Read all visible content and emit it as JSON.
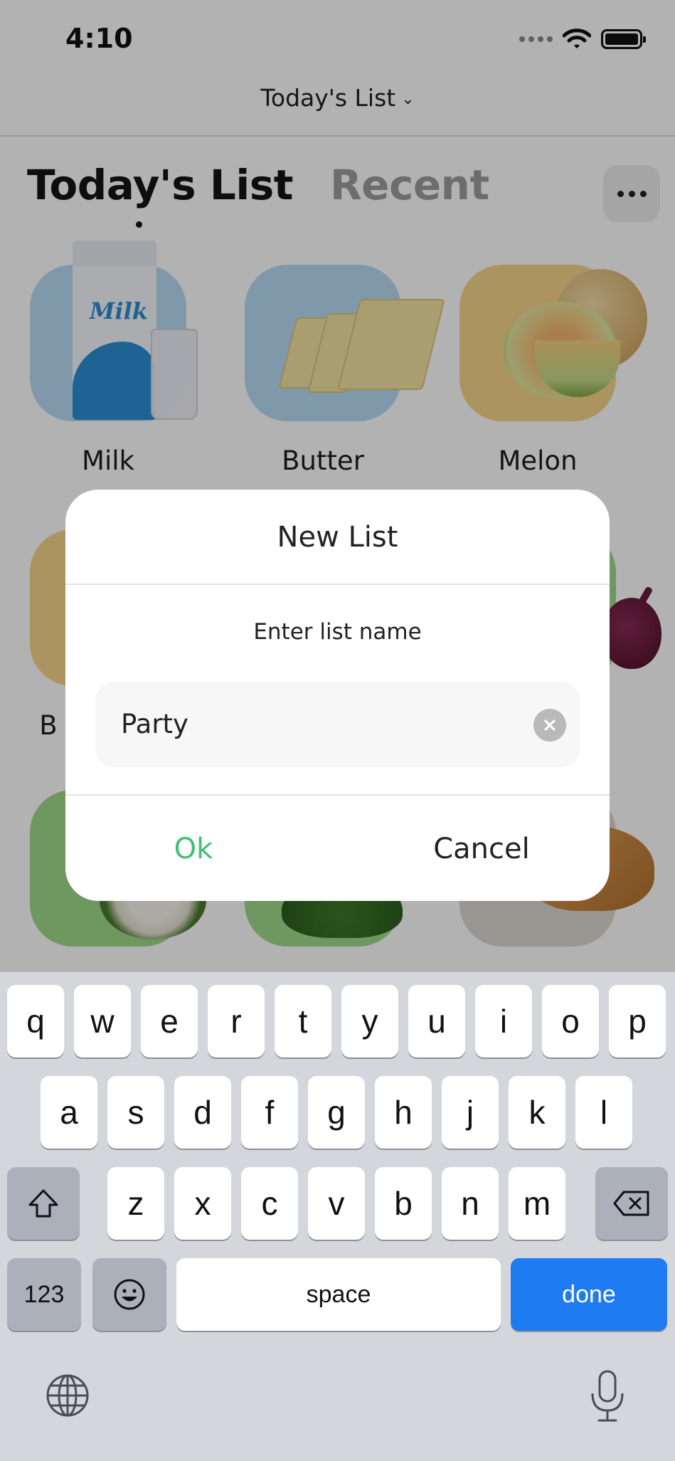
{
  "status_bar": {
    "time": "4:10"
  },
  "nav": {
    "title": "Today's List",
    "chevron": "⌄"
  },
  "tabs": [
    {
      "label": "Today's List",
      "active": true
    },
    {
      "label": "Recent",
      "active": false
    }
  ],
  "products": [
    {
      "name": "Milk",
      "tile_color": "#b8dcf4"
    },
    {
      "name": "Butter",
      "tile_color": "#b8dcf4"
    },
    {
      "name": "Melon",
      "tile_color": "#f7d58a"
    }
  ],
  "partial_label": "B",
  "dialog": {
    "title": "New List",
    "prompt": "Enter list name",
    "input_value": "Party",
    "ok_label": "Ok",
    "cancel_label": "Cancel"
  },
  "keyboard": {
    "row1": [
      "q",
      "w",
      "e",
      "r",
      "t",
      "y",
      "u",
      "i",
      "o",
      "p"
    ],
    "row2": [
      "a",
      "s",
      "d",
      "f",
      "g",
      "h",
      "j",
      "k",
      "l"
    ],
    "row3": [
      "z",
      "x",
      "c",
      "v",
      "b",
      "n",
      "m"
    ],
    "numbers_label": "123",
    "space_label": "space",
    "done_label": "done"
  },
  "colors": {
    "accent_green": "#3ec26f",
    "done_blue": "#1f7bf2"
  }
}
